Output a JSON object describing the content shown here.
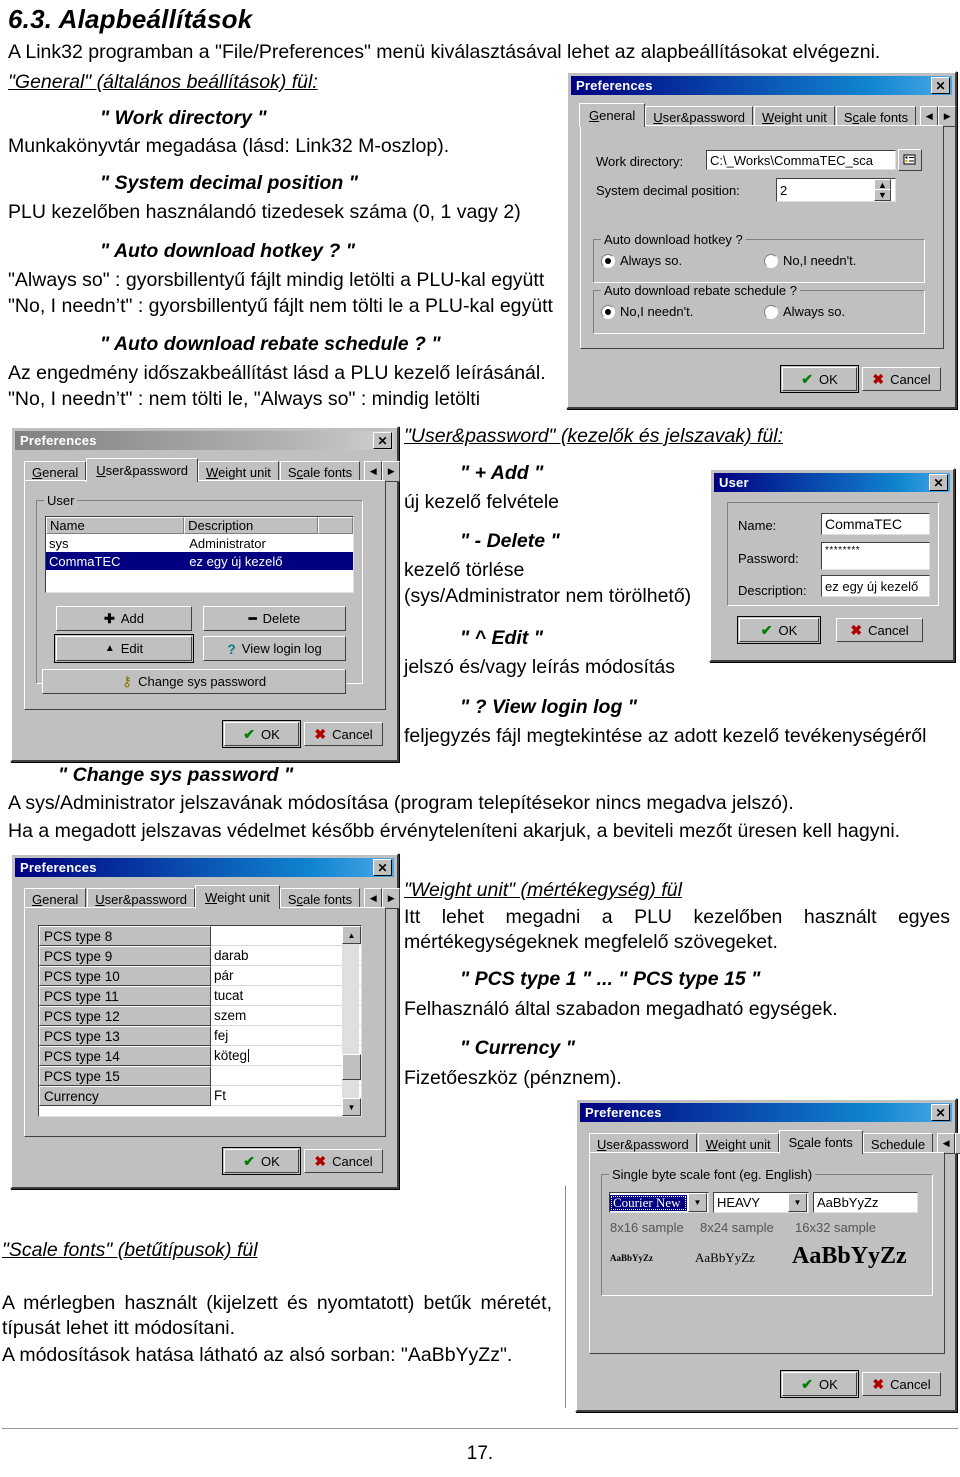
{
  "document": {
    "heading": "6.3. Alapbeállítások",
    "intro": "A Link32 programban a \"File/Preferences\" menü kiválasztásával lehet az alapbeállításokat elvégezni.",
    "section_general_title": "\"General\" (általános beállítások) fül:",
    "term_work_directory": "\" Work directory \"",
    "desc_work_directory": "Munkakönyvtár megadása (lásd: Link32 M-oszlop).",
    "term_system_decimal": "\" System decimal position \"",
    "desc_system_decimal": "PLU kezelőben használandó tizedesek száma (0, 1 vagy 2)",
    "term_auto_hotkey": "\" Auto download hotkey ? \"",
    "desc_hotkey_always": "\"Always so\" : gyorsbillentyű fájlt mindig letölti a PLU-kal együtt",
    "desc_hotkey_no": "\"No, I needn’t\" : gyorsbillentyű fájlt nem tölti le a PLU-kal együtt",
    "term_auto_rebate": "\" Auto download rebate schedule ? \"",
    "desc_rebate_1": "Az engedmény időszakbeállítást lásd a PLU kezelő leírásánál.",
    "desc_rebate_2": "\"No, I needn’t\" : nem tölti le,   \"Always so\" :  mindig letölti",
    "section_user_title": "\"User&password\" (kezelők és jelszavak) fül:",
    "term_add": "\" + Add \"",
    "desc_add": "új kezelő felvétele",
    "term_delete": "\" - Delete \"",
    "desc_delete_1": "kezelő törlése",
    "desc_delete_2": "(sys/Administrator nem törölhető)",
    "term_edit": "\" ^ Edit \"",
    "desc_edit": "jelszó és/vagy leírás módosítás",
    "term_viewlog": "\" ? View login log \"",
    "desc_viewlog": "feljegyzés fájl megtekintése az adott kezelő tevékenységéről",
    "term_changepw": "\" Change sys password \"",
    "desc_changepw_1": "A sys/Administrator jelszavának módosítása (program telepítésekor nincs megadva jelszó).",
    "desc_changepw_2": "Ha a megadott jelszavas védelmet később érvényteleníteni akarjuk, a beviteli mezőt üresen kell hagyni.",
    "section_weight_title": "\"Weight unit\" (mértékegység) fül",
    "desc_weight": "Itt lehet megadni a PLU kezelőben használt egyes mértékegységeknek megfelelő szövegeket.",
    "term_pcs": "\" PCS type 1 \" ... \" PCS type 15 \"",
    "desc_pcs": "Felhasználó által szabadon megadható egységek.",
    "term_currency": "\" Currency \"",
    "desc_currency": "Fizetőeszköz (pénznem).",
    "section_scalefonts_title": "\"Scale fonts\" (betűtípusok) fül",
    "desc_scalefonts_1": "A mérlegben használt (kijelzett és nyomtatott) betűk méretét, típusát lehet itt módosítani.",
    "desc_scalefonts_2": "A módosítások hatása látható az alsó sorban:  \"AaBbYyZz\".",
    "page_number": "17."
  },
  "dlg_general": {
    "title": "Preferences",
    "close": "✕",
    "tabs": [
      "General",
      "User&password",
      "Weight unit",
      "Scale fonts"
    ],
    "active_tab": "General",
    "tab_prev": "◀",
    "tab_next": "▶",
    "work_dir_label": "Work directory:",
    "work_dir_value": "C:\\_Works\\CommaTEC_sca",
    "decimal_label": "System decimal position:",
    "decimal_value": "2",
    "spin_up": "▲",
    "spin_down": "▼",
    "group_hotkey": "Auto download hotkey ?",
    "hotkey_opt1": "Always so.",
    "hotkey_opt2": "No,I needn't.",
    "hotkey_selected": "Always so.",
    "group_rebate": "Auto download rebate schedule ?",
    "rebate_opt1": "No,I needn't.",
    "rebate_opt2": "Always so.",
    "rebate_selected": "No,I needn't.",
    "ok": "OK",
    "cancel": "Cancel"
  },
  "dlg_user_tab": {
    "title": "Preferences",
    "close": "✕",
    "tabs": [
      "General",
      "User&password",
      "Weight unit",
      "Scale fonts"
    ],
    "active_tab": "User&password",
    "tab_prev": "◀",
    "tab_next": "▶",
    "group_user": "User",
    "col_name": "Name",
    "col_description": "Description",
    "rows": [
      {
        "name": "sys",
        "description": "Administrator",
        "selected": false
      },
      {
        "name": "CommaTEC",
        "description": "ez egy új kezelő",
        "selected": true
      }
    ],
    "btn_add": "Add",
    "btn_delete": "Delete",
    "btn_edit": "Edit",
    "btn_viewlog": "View login log",
    "btn_changepw": "Change sys password",
    "icon_add": "✚",
    "icon_delete": "━",
    "icon_edit": "▲",
    "icon_help": "?",
    "icon_key": "⚷",
    "ok": "OK",
    "cancel": "Cancel"
  },
  "dlg_user_edit": {
    "title": "User",
    "close": "✕",
    "name_label": "Name:",
    "name_value": "CommaTEC",
    "password_label": "Password:",
    "password_value": "********",
    "description_label": "Description:",
    "description_value": "ez egy új kezelő",
    "ok": "OK",
    "cancel": "Cancel"
  },
  "dlg_weight": {
    "title": "Preferences",
    "close": "✕",
    "tabs": [
      "General",
      "User&password",
      "Weight unit",
      "Scale fonts"
    ],
    "active_tab": "Weight unit",
    "tab_prev": "◀",
    "tab_next": "▶",
    "rows": [
      {
        "label": "PCS type 8",
        "value": ""
      },
      {
        "label": "PCS type 9",
        "value": "darab"
      },
      {
        "label": "PCS type 10",
        "value": "pár"
      },
      {
        "label": "PCS type 11",
        "value": "tucat"
      },
      {
        "label": "PCS type 12",
        "value": "szem"
      },
      {
        "label": "PCS type 13",
        "value": "fej"
      },
      {
        "label": "PCS type 14",
        "value": "köteg"
      },
      {
        "label": "PCS type 15",
        "value": ""
      },
      {
        "label": "Currency",
        "value": "Ft"
      }
    ],
    "scroll_up": "▲",
    "scroll_down": "▼",
    "ok": "OK",
    "cancel": "Cancel"
  },
  "dlg_scalefonts": {
    "title": "Preferences",
    "close": "✕",
    "tabs": [
      "User&password",
      "Weight unit",
      "Scale fonts",
      "Schedule"
    ],
    "active_tab": "Scale fonts",
    "tab_prev": "◀",
    "tab_next": "▶",
    "group_label": "Single byte scale font (eg. English)",
    "font_value": "Courier New",
    "weight_value": "HEAVY",
    "preview_value": "AaBbYyZz",
    "arrow": "▼",
    "sample_labels": [
      "8x16 sample",
      "8x24 sample",
      "16x32 sample"
    ],
    "samples": [
      "AaBbYyZz",
      "AaBbYyZz",
      "AaBbYyZz"
    ],
    "ok": "OK",
    "cancel": "Cancel"
  }
}
